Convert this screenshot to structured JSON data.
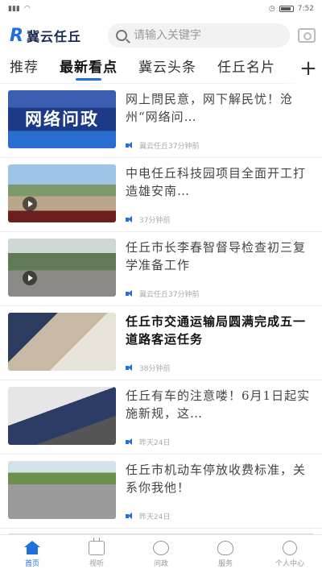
{
  "status_bar": {
    "time": "7:52"
  },
  "header": {
    "logo_mark": "R",
    "logo_text": "冀云任丘",
    "search_placeholder": "请输入关键字"
  },
  "tabs": [
    {
      "label": "推荐",
      "active": false
    },
    {
      "label": "最新看点",
      "active": true
    },
    {
      "label": "冀云头条",
      "active": false
    },
    {
      "label": "任丘名片",
      "active": false
    }
  ],
  "tab_add": "+",
  "news": [
    {
      "title": "网上問民意，网下解民忧！沧州“网络问…",
      "meta": "冀云任丘37分钟前",
      "thumb_label": "网络问政",
      "video": false
    },
    {
      "title": "中电任丘科技园项目全面开工打造雄安南…",
      "meta": "37分钟前",
      "thumb_label": "",
      "video": true
    },
    {
      "title": "任丘市长李春智督导检查初三复学准备工作",
      "meta": "冀云任丘37分钟前",
      "thumb_label": "",
      "video": true
    },
    {
      "title": "任丘市交通运输局圆满完成五一道路客运任务",
      "meta": "38分钟前",
      "thumb_label": "",
      "video": false
    },
    {
      "title": "任丘有车的注意喽！6月1日起实施新规，这…",
      "meta": "昨天24日",
      "thumb_label": "",
      "video": false
    },
    {
      "title": "任丘市机动车停放收费标准，关系你我他！",
      "meta": "昨天24日",
      "thumb_label": "",
      "video": false
    }
  ],
  "bottom_nav": [
    {
      "label": "首页",
      "icon": "home-icon",
      "active": true
    },
    {
      "label": "视听",
      "icon": "tv-icon",
      "active": false
    },
    {
      "label": "问政",
      "icon": "chat-icon",
      "active": false
    },
    {
      "label": "服务",
      "icon": "heart-icon",
      "active": false
    },
    {
      "label": "个人中心",
      "icon": "user-icon",
      "active": false
    }
  ],
  "colors": {
    "accent": "#1f6fe0"
  }
}
